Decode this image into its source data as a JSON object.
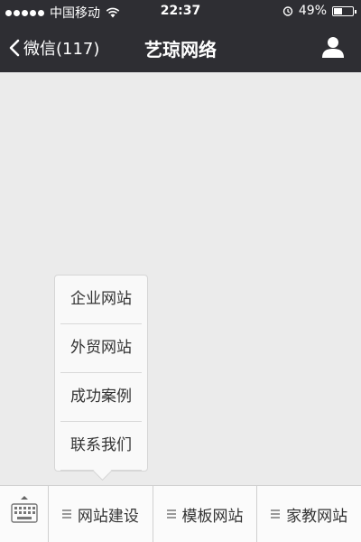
{
  "status_bar": {
    "carrier": "中国移动",
    "time": "22:37",
    "battery": "49%",
    "battery_level": 0.49
  },
  "nav": {
    "back_label": "微信(117)",
    "title": "艺琼网络"
  },
  "popup_menu": {
    "items": [
      "企业网站",
      "外贸网站",
      "成功案例",
      "联系我们"
    ]
  },
  "bottom_menu": {
    "items": [
      "网站建设",
      "模板网站",
      "家教网站"
    ]
  },
  "icons": {
    "back": "chevron-left-icon",
    "profile": "person-icon",
    "keyboard": "keyboard-icon",
    "menu": "hamburger-icon"
  }
}
